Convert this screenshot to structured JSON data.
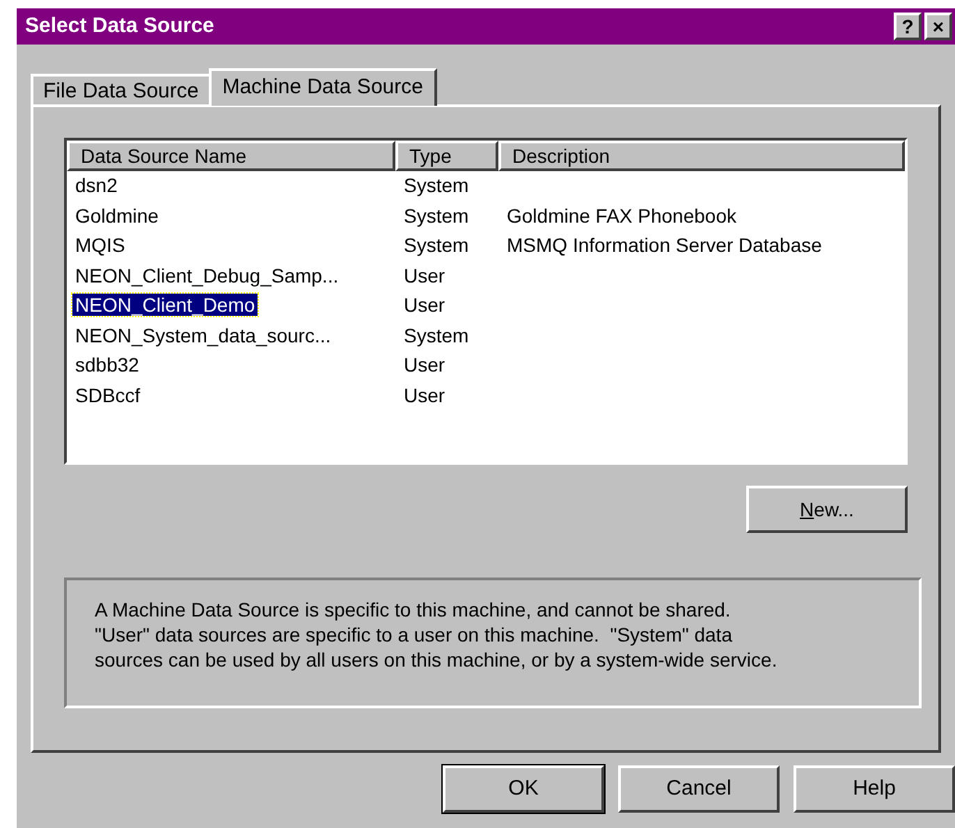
{
  "window": {
    "title": "Select Data Source",
    "title_buttons": [
      "?",
      "×"
    ]
  },
  "tabs": [
    {
      "label": "File Data Source",
      "selected": false
    },
    {
      "label": "Machine Data Source",
      "selected": true
    }
  ],
  "table": {
    "columns": [
      "Data Source Name",
      "Type",
      "Description"
    ],
    "rows": [
      {
        "cells": [
          "dsn2",
          "System",
          ""
        ],
        "selected": false
      },
      {
        "cells": [
          "Goldmine",
          "System",
          "Goldmine FAX Phonebook"
        ],
        "selected": false
      },
      {
        "cells": [
          "MQIS",
          "System",
          "MSMQ Information Server Database"
        ],
        "selected": false
      },
      {
        "cells": [
          "NEON_Client_Debug_Samp...",
          "User",
          ""
        ],
        "selected": false
      },
      {
        "cells": [
          "NEON_Client_Demo",
          "User",
          ""
        ],
        "selected": true
      },
      {
        "cells": [
          "NEON_System_data_sourc...",
          "System",
          ""
        ],
        "selected": false
      },
      {
        "cells": [
          "sdbb32",
          "User",
          ""
        ],
        "selected": false
      },
      {
        "cells": [
          "SDBccf",
          "User",
          ""
        ],
        "selected": false
      }
    ]
  },
  "new_button": {
    "label": "New...",
    "access_key_underlined": true
  },
  "info_text": "A Machine Data Source is specific to this machine, and cannot be shared.\n\"User\" data sources are specific to a user on this machine.  \"System\" data\nsources can be used by all users on this machine, or by a system-wide service.",
  "buttons": [
    {
      "label": "OK",
      "default": true
    },
    {
      "label": "Cancel",
      "default": false
    },
    {
      "label": "Help",
      "default": false
    }
  ]
}
